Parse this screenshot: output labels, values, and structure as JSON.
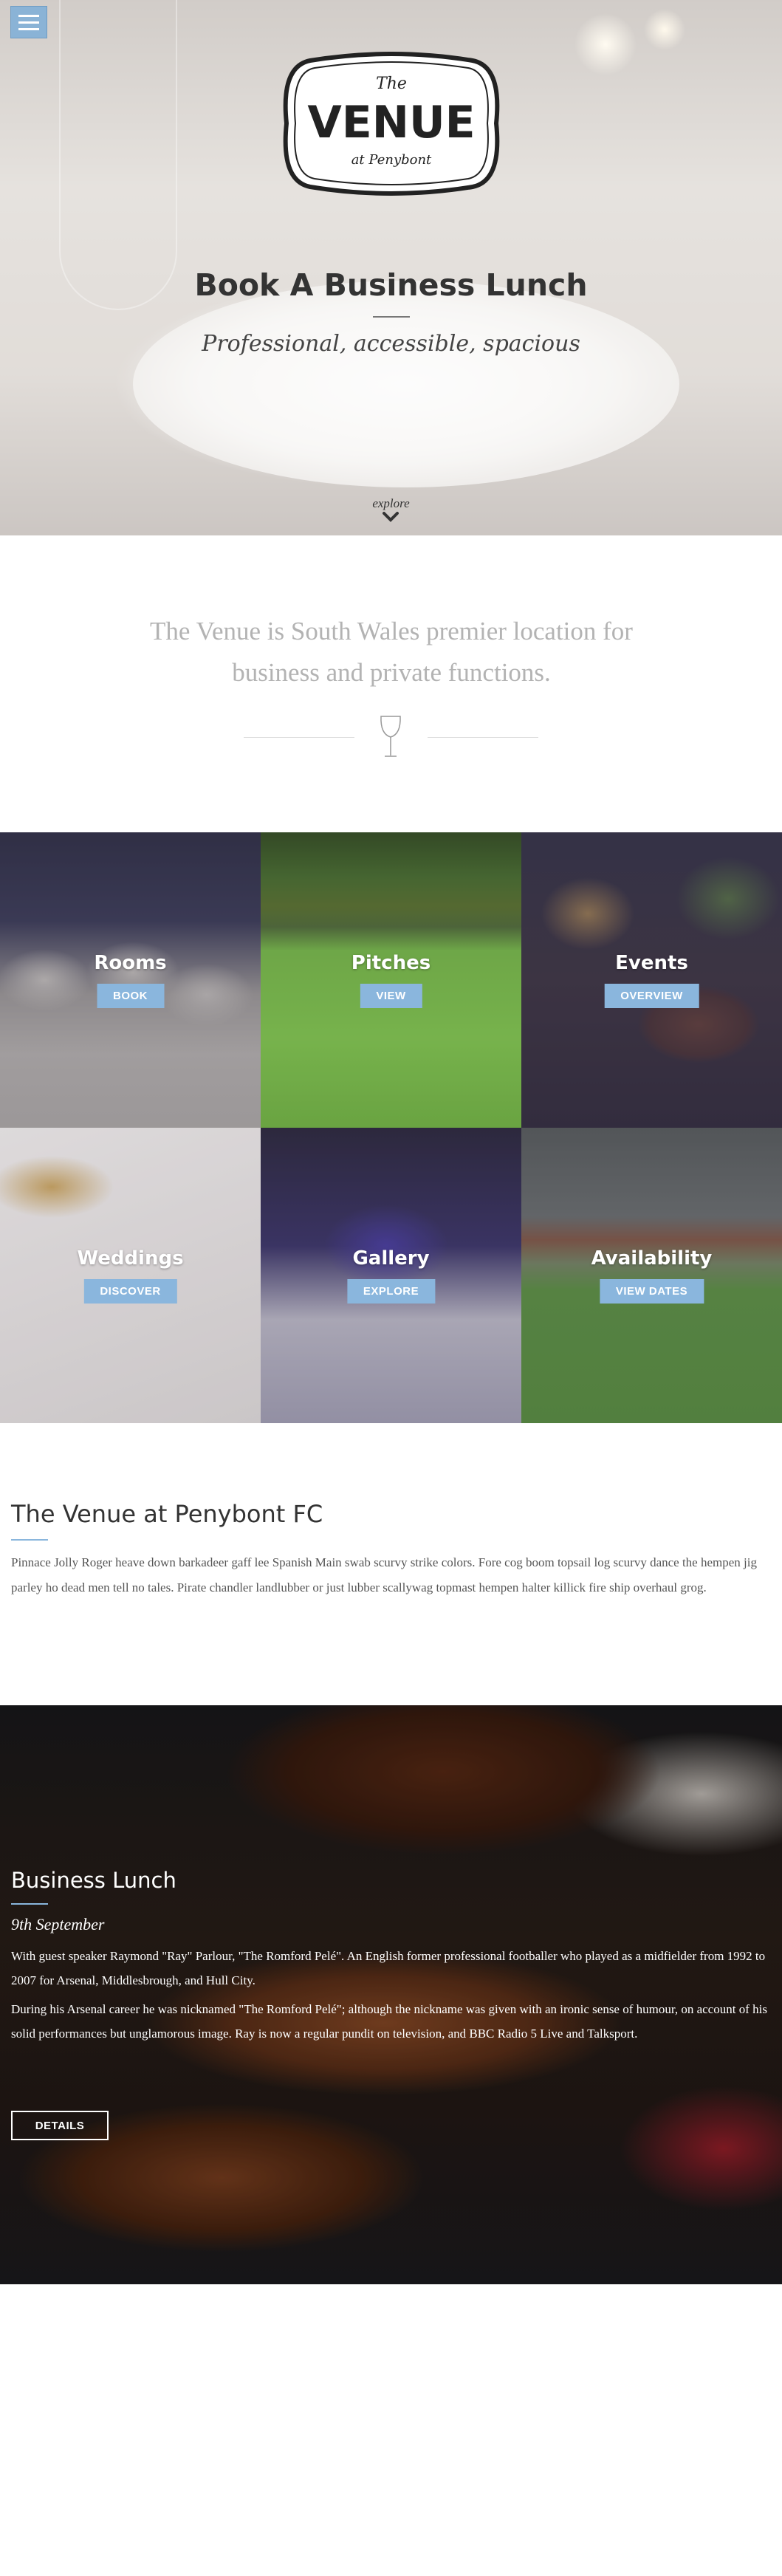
{
  "hero": {
    "logo_the": "The",
    "logo_venue": "VENUE",
    "logo_at": "at Penybont",
    "title_light": "Book A ",
    "title_bold": "Business Lunch",
    "subtitle": "Professional, accessible, spacious",
    "explore": "explore"
  },
  "intro": {
    "text": "The Venue is South Wales premier location for business and private functions."
  },
  "tiles": [
    {
      "title": "Rooms",
      "button": "BOOK"
    },
    {
      "title": "Pitches",
      "button": "VIEW"
    },
    {
      "title": "Events",
      "button": "OVERVIEW"
    },
    {
      "title": "Weddings",
      "button": "DISCOVER"
    },
    {
      "title": "Gallery",
      "button": "EXPLORE"
    },
    {
      "title": "Availability",
      "button": "VIEW DATES"
    }
  ],
  "about": {
    "heading": "The Venue at Penybont FC",
    "body": "Pinnace Jolly Roger heave down barkadeer gaff lee Spanish Main swab scurvy strike colors. Fore cog boom topsail log scurvy dance the hempen jig parley ho dead men tell no tales. Pirate chandler landlubber or just lubber scallywag topmast hempen halter killick fire ship overhaul grog."
  },
  "event": {
    "heading": "Business Lunch",
    "date": "9th September",
    "p1": "With guest speaker Raymond \"Ray\" Parlour, \"The Romford Pelé\". An English former professional footballer who played as a midfielder from 1992 to 2007 for Arsenal, Middlesbrough, and Hull City.",
    "p2": "During his Arsenal career he was nicknamed \"The Romford Pelé\"; although the nickname was given with an ironic sense of humour, on account of his solid performances but unglamorous image. Ray is now a regular pundit on television, and BBC Radio 5 Live and Talksport.",
    "button": "DETAILS"
  },
  "colors": {
    "accent": "#8ab6dd",
    "menu": "#8ab3d6"
  },
  "icons": {
    "menu": "hamburger-icon",
    "explore": "chevron-down-icon",
    "intro": "wine-glass-icon"
  }
}
